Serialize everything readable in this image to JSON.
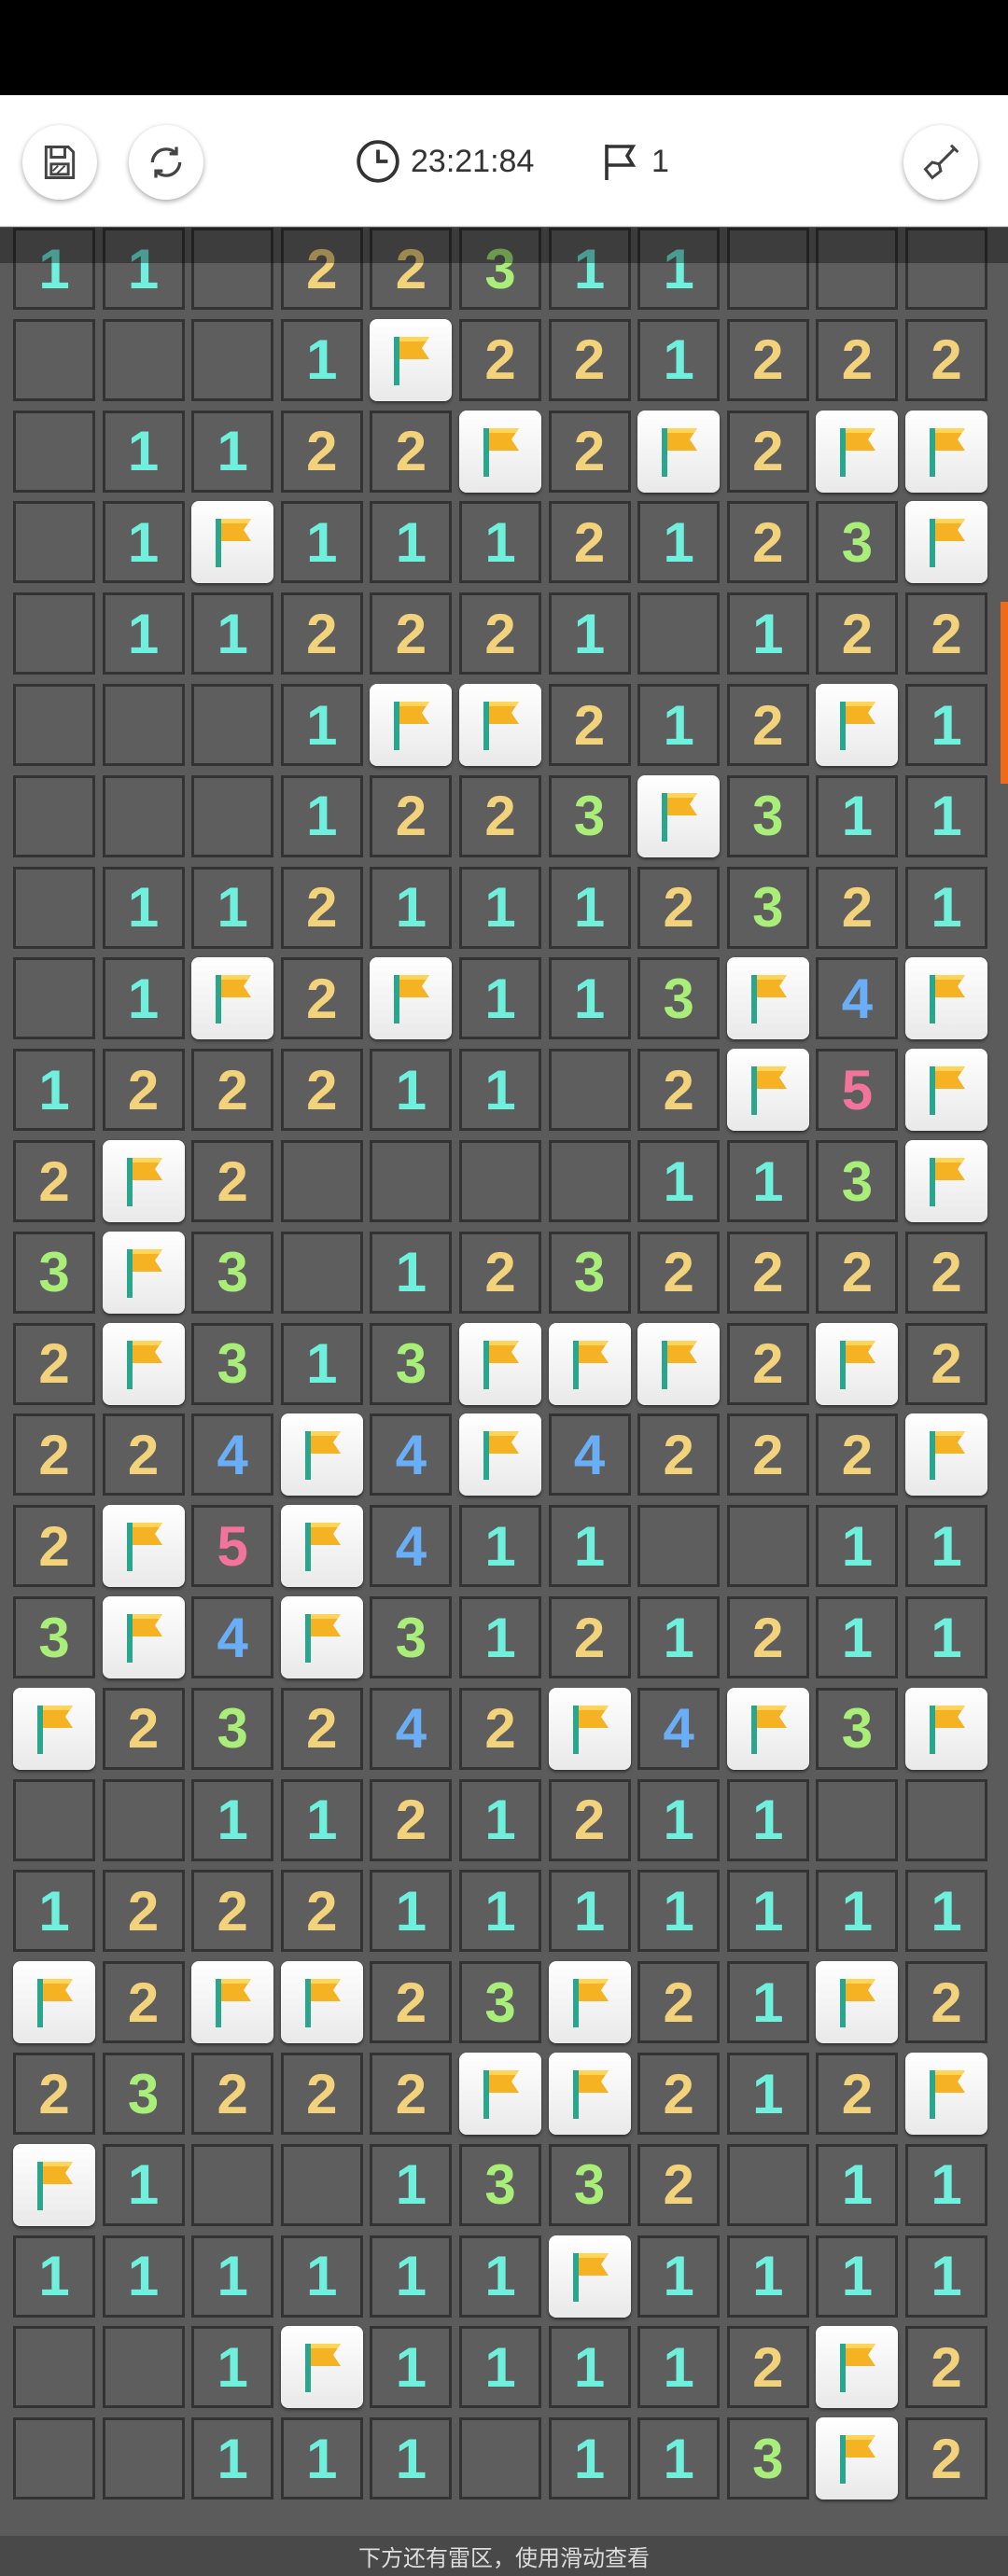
{
  "toolbar": {
    "save_icon": "save-icon",
    "restart_icon": "restart-icon",
    "timer": "23:21:84",
    "timer_icon": "clock-icon",
    "flag_count": "1",
    "flag_icon": "flag-outline-icon",
    "tool_icon": "shovel-icon"
  },
  "board": {
    "cols": 11,
    "legend": {
      "0": "empty-revealed",
      "F": "flagged",
      "1": "one",
      "2": "two",
      "3": "three",
      "4": "four",
      "5": "five"
    },
    "rows": [
      "11.22311...",
      "...1F221222",
      ".1122F2F2FF",
      ".1F1112123F",
      ".112221.122",
      "...1FF212F1",
      "...1223F311",
      ".1121112321",
      ".1F2F113F4F",
      "122211.2F5F",
      "2F2....113F",
      "3F3.1232222",
      "2F313FFF2F2",
      "224F4F4222F",
      "2F5F411..11",
      "3F4F3121211",
      "F23242F4F3F",
      "..1121211..",
      "12221111111",
      "F2FF23F21F2",
      "23222FF212F",
      "F1..1332.11",
      "111111F1111",
      "..1F11112F2",
      "..111.113F2"
    ]
  },
  "colors": {
    "one": "#6ff0dd",
    "two": "#f2d27a",
    "three": "#a8ee78",
    "four": "#6aaef7",
    "five": "#f2749c",
    "flag": "#f5b324"
  },
  "hint": "下方还有雷区，使用滑动查看"
}
